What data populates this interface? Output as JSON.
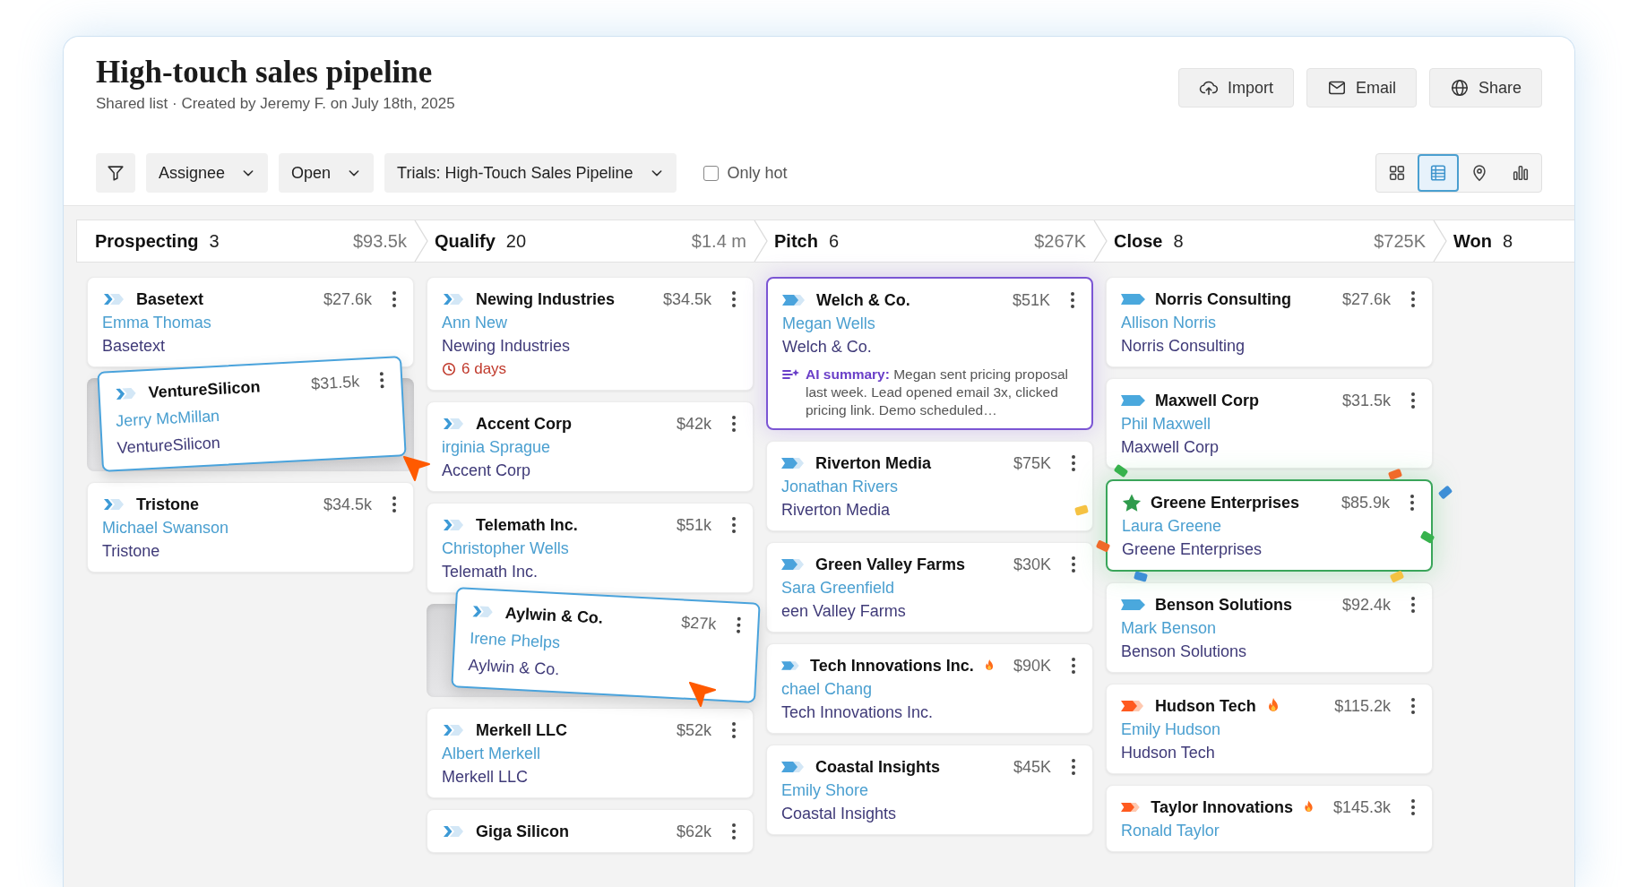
{
  "header": {
    "title": "High-touch sales pipeline",
    "subtitle": "Shared list · Created by Jeremy F. on July 18th, 2025"
  },
  "actions": [
    {
      "kind": "import",
      "label": "Import"
    },
    {
      "kind": "email",
      "label": "Email"
    },
    {
      "kind": "share",
      "label": "Share"
    }
  ],
  "filters": {
    "dropdowns": [
      {
        "label": "Assignee"
      },
      {
        "label": "Open"
      },
      {
        "label": "Trials: High-Touch Sales Pipeline"
      }
    ],
    "only_hot": {
      "label": "Only hot",
      "checked": false
    }
  },
  "views": [
    {
      "kind": "grid",
      "selected": false
    },
    {
      "kind": "table",
      "selected": true
    },
    {
      "kind": "map",
      "selected": false
    },
    {
      "kind": "chart",
      "selected": false
    }
  ],
  "stages": [
    {
      "name": "Prospecting",
      "count": "3",
      "total": "$93.5k",
      "cards": [
        {
          "kind": "chevron",
          "company": "Basetext",
          "amount": "$27.6k",
          "contact": "Emma Thomas",
          "account": "Basetext",
          "dragging": false,
          "hot": false,
          "celebrating": false
        },
        {
          "kind": "chevron",
          "company": "VentureSilicon",
          "amount": "$31.5k",
          "contact": "Jerry McMillan",
          "account": "VentureSilicon",
          "dragging": true,
          "hot": false,
          "celebrating": false
        },
        {
          "kind": "chevron",
          "company": "Tristone",
          "amount": "$34.5k",
          "contact": "Michael Swanson",
          "account": "Tristone",
          "dragging": false,
          "hot": false,
          "celebrating": false
        }
      ]
    },
    {
      "name": "Qualify",
      "count": "20",
      "total": "$1.4 m",
      "cards": [
        {
          "kind": "chevron",
          "company": "Newing Industries",
          "amount": "$34.5k",
          "contact": "Ann New",
          "account": "Newing Industries",
          "due": "6 days",
          "dragging": false,
          "hot": false,
          "celebrating": false
        },
        {
          "kind": "chevron",
          "company": "Accent Corp",
          "amount": "$42k",
          "contact": "irginia Sprague",
          "account": "Accent Corp",
          "dragging": false,
          "hot": false,
          "celebrating": false
        },
        {
          "kind": "chevron",
          "company": "Telemath Inc.",
          "amount": "$51k",
          "contact": "Christopher Wells",
          "account": "Telemath Inc.",
          "dragging": false,
          "hot": false,
          "celebrating": false
        },
        {
          "kind": "chevron",
          "company": "Aylwin & Co.",
          "amount": "$27k",
          "contact": "Irene Phelps",
          "account": "Aylwin & Co.",
          "dragging": true,
          "hot": false,
          "celebrating": false
        },
        {
          "kind": "chevron",
          "company": "Merkell LLC",
          "amount": "$52k",
          "contact": "Albert Merkell",
          "account": "Merkell LLC",
          "dragging": false,
          "hot": false,
          "celebrating": false
        },
        {
          "kind": "chevron",
          "company": "Giga Silicon",
          "amount": "$62k",
          "dragging": false,
          "hot": false,
          "celebrating": false
        }
      ]
    },
    {
      "name": "Pitch",
      "count": "6",
      "total": "$267K",
      "cards": [
        {
          "kind": "arrow",
          "company": "Welch & Co.",
          "amount": "$51K",
          "contact": "Megan Wells",
          "account": "Welch & Co.",
          "ai_summary": "**AI summary:** Megan sent pricing proposal last week. Lead opened email 3x, clicked pricing link. Demo scheduled…",
          "dragging": false,
          "hot": false,
          "celebrating": false
        },
        {
          "kind": "arrow",
          "company": "Riverton Media",
          "amount": "$75K",
          "contact": "Jonathan Rivers",
          "account": "Riverton Media",
          "dragging": false,
          "hot": false,
          "celebrating": false
        },
        {
          "kind": "arrow",
          "company": "Green Valley Farms",
          "amount": "$30K",
          "contact": "Sara Greenfield",
          "account": "een Valley Farms",
          "dragging": false,
          "hot": false,
          "celebrating": false
        },
        {
          "kind": "arrow",
          "company": "Tech Innovations Inc.",
          "amount": "$90K",
          "contact": "chael Chang",
          "account": "Tech Innovations Inc.",
          "dragging": false,
          "hot": true,
          "celebrating": false
        },
        {
          "kind": "arrow",
          "company": "Coastal Insights",
          "amount": "$45K",
          "contact": "Emily Shore",
          "account": "Coastal Insights",
          "dragging": false,
          "hot": false,
          "celebrating": false
        }
      ]
    },
    {
      "name": "Close",
      "count": "8",
      "total": "$725K",
      "cards": [
        {
          "kind": "tag",
          "company": "Norris Consulting",
          "amount": "$27.6k",
          "contact": "Allison Norris",
          "account": "Norris Consulting",
          "dragging": false,
          "hot": false,
          "celebrating": false
        },
        {
          "kind": "tag",
          "company": "Maxwell Corp",
          "amount": "$31.5k",
          "contact": "Phil Maxwell",
          "account": "Maxwell Corp",
          "dragging": false,
          "hot": false,
          "celebrating": false
        },
        {
          "kind": "star",
          "company": "Greene Enterprises",
          "amount": "$85.9k",
          "contact": "Laura Greene",
          "account": "Greene Enterprises",
          "dragging": false,
          "hot": false,
          "celebrating": true
        },
        {
          "kind": "tag",
          "company": "Benson Solutions",
          "amount": "$92.4k",
          "contact": "Mark Benson",
          "account": "Benson Solutions",
          "dragging": false,
          "hot": false,
          "celebrating": false
        },
        {
          "kind": "hot",
          "company": "Hudson Tech",
          "amount": "$115.2k",
          "contact": "Emily Hudson",
          "account": "Hudson Tech",
          "dragging": false,
          "hot": true,
          "celebrating": false
        },
        {
          "kind": "hot",
          "company": "Taylor Innovations",
          "amount": "$145.3k",
          "contact": "Ronald Taylor",
          "dragging": false,
          "hot": true,
          "celebrating": false
        }
      ]
    },
    {
      "name": "Won",
      "count": "8"
    }
  ]
}
